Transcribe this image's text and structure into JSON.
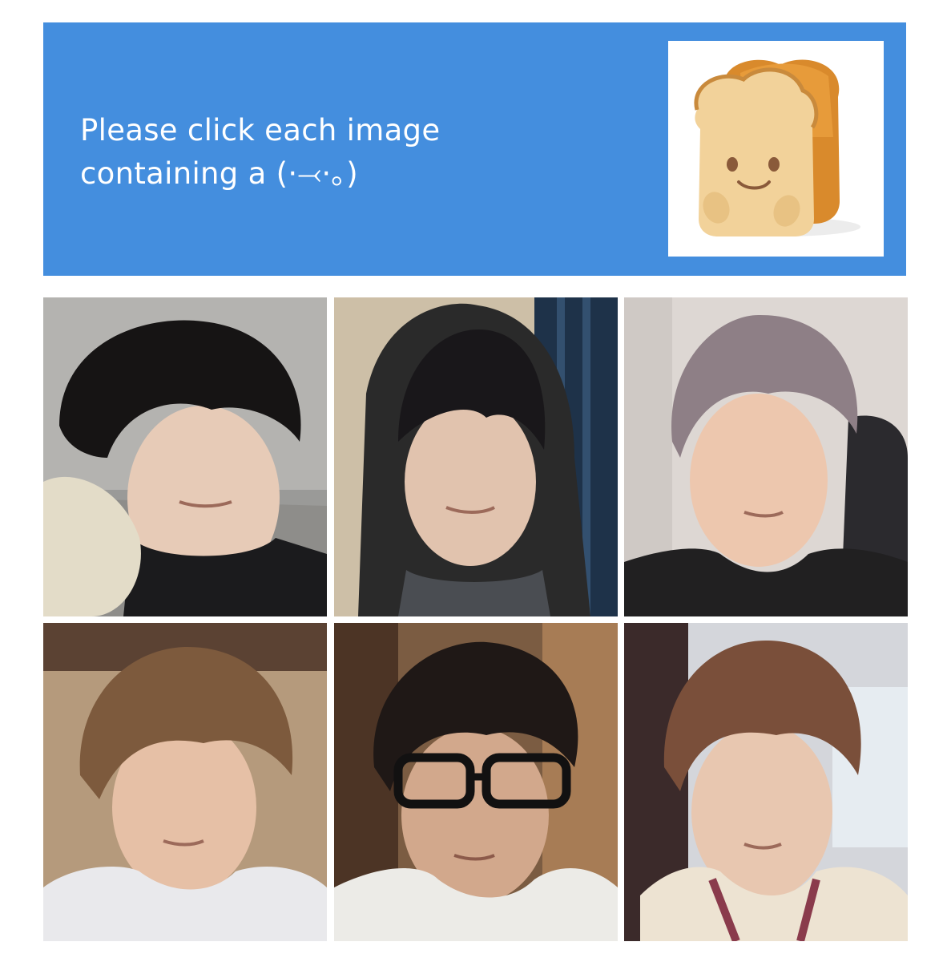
{
  "header": {
    "prompt_line1": "Please click each image",
    "prompt_line2": "containing a (·⤙·｡)",
    "background_color": "#448ede",
    "text_color": "#ffffff",
    "reference_image": "bread-plush-toy"
  },
  "grid": {
    "rows": 2,
    "columns": 3,
    "tiles": [
      {
        "id": 1,
        "subject": "dark-haired-person-smiling"
      },
      {
        "id": 2,
        "subject": "person-in-black-hoodie"
      },
      {
        "id": 3,
        "subject": "light-brown-haired-person"
      },
      {
        "id": 4,
        "subject": "person-in-gray-hoodie"
      },
      {
        "id": 5,
        "subject": "person-with-black-glasses"
      },
      {
        "id": 6,
        "subject": "person-in-cream-jacket"
      }
    ]
  }
}
